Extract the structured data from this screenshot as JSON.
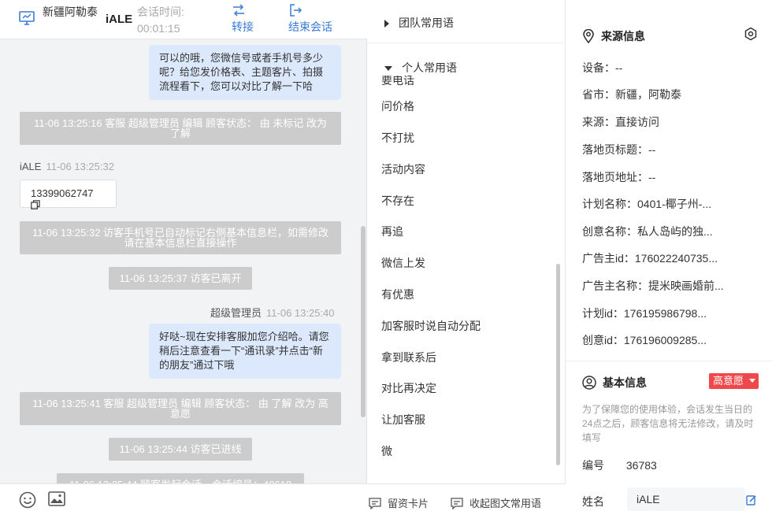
{
  "topbar": {
    "location": "新疆阿勒泰",
    "visitor": "iALE",
    "session_time_label": "会话时间:",
    "session_time": "00:01:15",
    "transfer": "转接",
    "end_session": "结束会话"
  },
  "chat": {
    "msg1": "可以的哦，您微信号或者手机号多少呢？给您发价格表、主题客片、拍摄流程看下，您可以对比了解一下哈",
    "sys1": "11-06 13:25:16 客服 超级管理员 编辑 顾客状态： 由 未标记 改为 了解",
    "visitor_name": "iALE",
    "visitor_time": "11-06 13:25:32",
    "phone": "13399062747",
    "sys2": "11-06 13:25:32 访客手机号已自动标记右侧基本信息栏，如需修改请在基本信息栏直接操作",
    "sys3": "11-06 13:25:37 访客已离开",
    "agent_name": "超级管理员",
    "agent_time": "11-06 13:25:40",
    "msg2": "好哒~现在安排客服加您介绍哈。请您稍后注意查看一下“通讯录”并点击“新的朋友”通过下哦",
    "sys4": "11-06 13:25:41 客服 超级管理员 编辑 顾客状态： 由 了解 改为 高意愿",
    "sys5": "11-06 13:25:44 访客已进线",
    "sys6": "11-06 13:25:44 顾客发起会话，会话编号：40618"
  },
  "phrases": {
    "team_group": "团队常用语",
    "personal_group": "个人常用语",
    "partial_item": "要电话",
    "items": [
      "问价格",
      "不打扰",
      "活动内容",
      "不存在",
      "再追",
      "微信上发",
      "有优惠",
      "加客服时说自动分配",
      "拿到联系后",
      "对比再决定",
      "让加客服",
      "微"
    ],
    "leave_card": "留资卡片",
    "collapse_phrases": "收起图文常用语"
  },
  "source": {
    "title": "来源信息",
    "fields": [
      "设备：--",
      "省市：新疆，阿勒泰",
      "来源：直接访问",
      "落地页标题：--",
      "落地页地址：--",
      "计划名称：0401-椰子州-...",
      "创意名称：私人岛屿的独...",
      "广告主id：176022240735...",
      "广告主名称：提米映画婚前...",
      "计划id：176195986798...",
      "创意id：176196009285..."
    ]
  },
  "basic": {
    "title": "基本信息",
    "intent": "高意愿",
    "note": "为了保障您的使用体验，会话发生当日的24点之后，顾客信息将无法修改，请及时填写",
    "id_label": "编号",
    "id_value": "36783",
    "name_label": "姓名",
    "name_value": "iALE"
  },
  "colors": {
    "accent": "#3a7bd5",
    "bubble": "#dce9fc",
    "system": "#cccccc",
    "badge": "#f0474b"
  }
}
